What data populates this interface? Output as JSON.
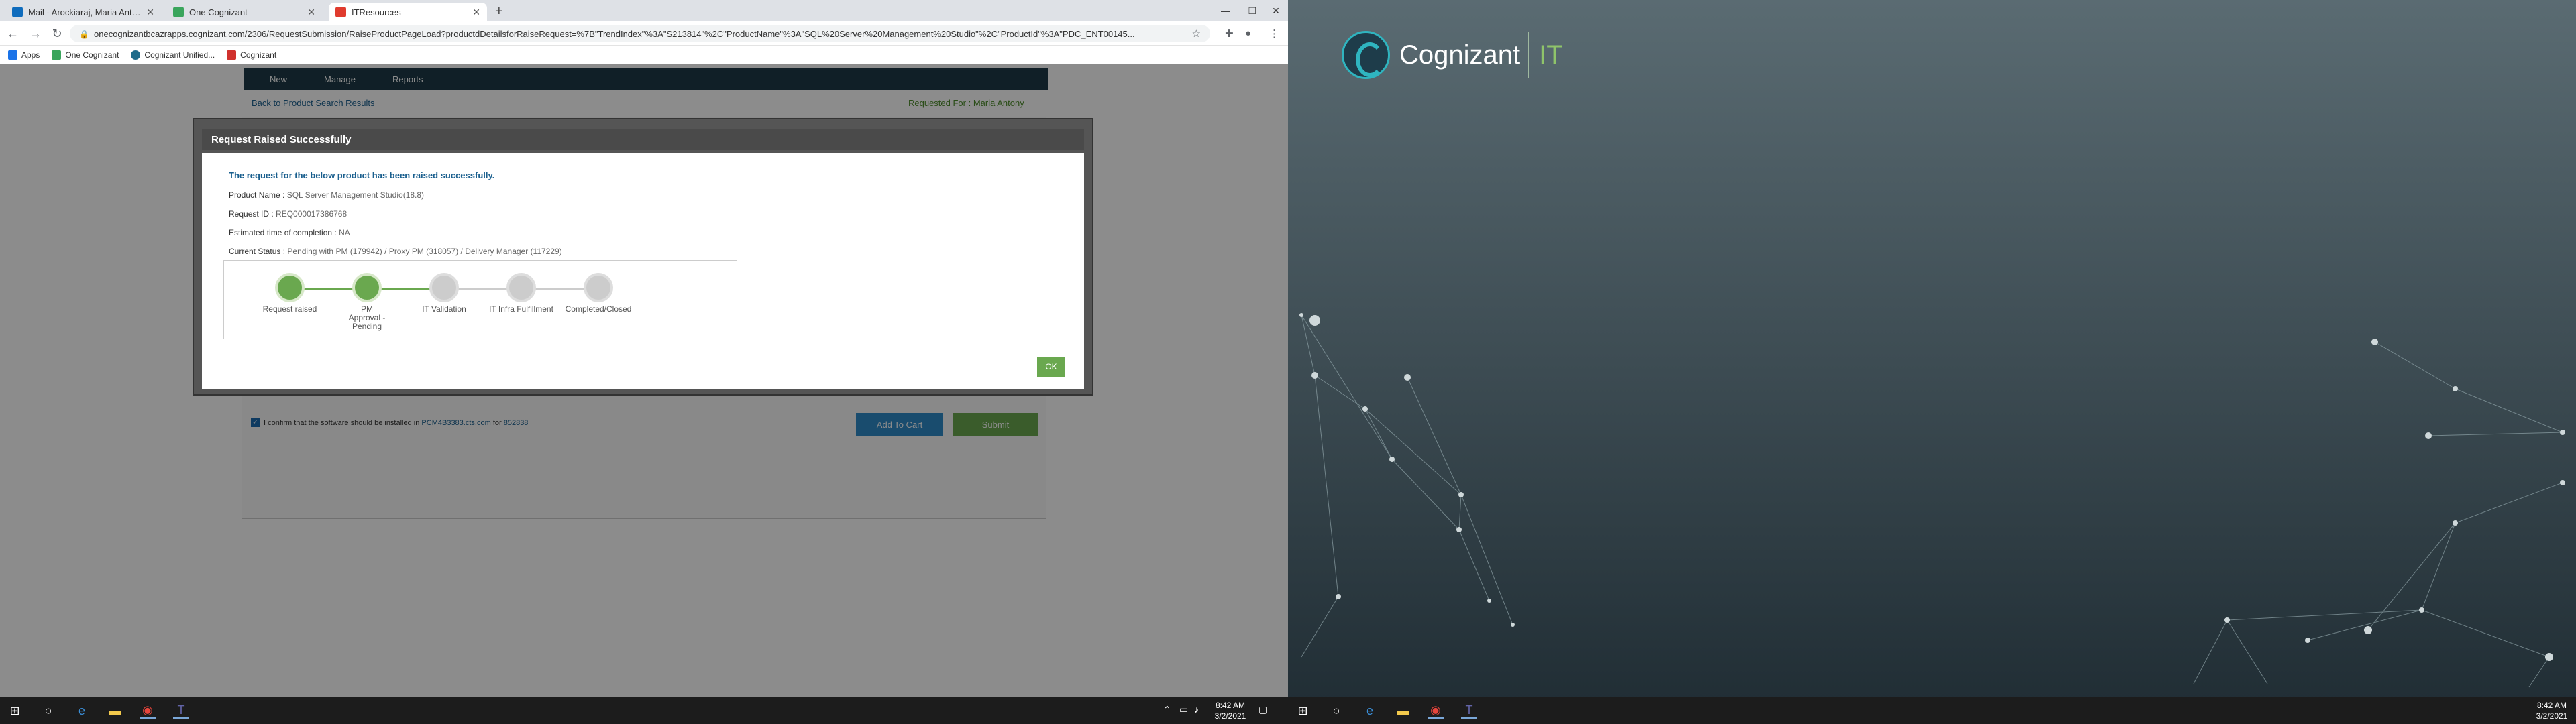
{
  "browser": {
    "tabs": [
      {
        "label": "Mail - Arockiaraj, Maria Antony",
        "color": "#0f6cbd"
      },
      {
        "label": "One Cognizant",
        "color": "#3aa55c"
      },
      {
        "label": "ITResources",
        "color": "#e03b2e"
      }
    ],
    "url": "onecognizantbcazrapps.cognizant.com/2306/RequestSubmission/RaiseProductPageLoad?productdDetailsforRaiseRequest=%7B\"TrendIndex\"%3A\"S213814\"%2C\"ProductName\"%3A\"SQL%20Server%20Management%20Studio\"%2C\"ProductId\"%3A\"PDC_ENT00145...",
    "bookmarks": [
      {
        "label": "Apps",
        "color": "#1a73e8"
      },
      {
        "label": "One Cognizant",
        "color": "#3aa55c"
      },
      {
        "label": "Cognizant Unified...",
        "color": "#1e6b8a"
      },
      {
        "label": "Cognizant",
        "color": "#d0312d"
      }
    ]
  },
  "site": {
    "nav": [
      "New",
      "Manage",
      "Reports"
    ],
    "back_link": "Back to Product Search Results",
    "requested_for": "Requested For : Maria Antony",
    "confirm_text": "I confirm that the software should be installed in",
    "confirm_host": "PCM4B3383.cts.com",
    "confirm_for": "for",
    "confirm_id": "852838",
    "add_to_cart": "Add To Cart",
    "submit": "Submit"
  },
  "modal": {
    "title": "Request Raised Successfully",
    "success": "The request for the below product has been raised successfully.",
    "product_label": "Product Name :",
    "product_value": "SQL Server Management Studio(18.8)",
    "request_label": "Request ID :",
    "request_value": "REQ000017386768",
    "eta_label": "Estimated time of completion :",
    "eta_value": "NA",
    "status_label": "Current Status :",
    "status_value": "Pending with PM (179942) / Proxy PM (318057) / Delivery Manager (117229)",
    "steps": [
      {
        "label": "Request raised",
        "done": true
      },
      {
        "label": "PM Approval -Pending",
        "done": true
      },
      {
        "label": "IT Validation",
        "done": false
      },
      {
        "label": "IT Infra Fulfillment",
        "done": false
      },
      {
        "label": "Completed/Closed",
        "done": false
      }
    ],
    "ok": "OK"
  },
  "taskbar": {
    "time": "8:42 AM",
    "date": "3/2/2021"
  },
  "brand": {
    "name": "Cognizant",
    "suffix": "IT"
  }
}
